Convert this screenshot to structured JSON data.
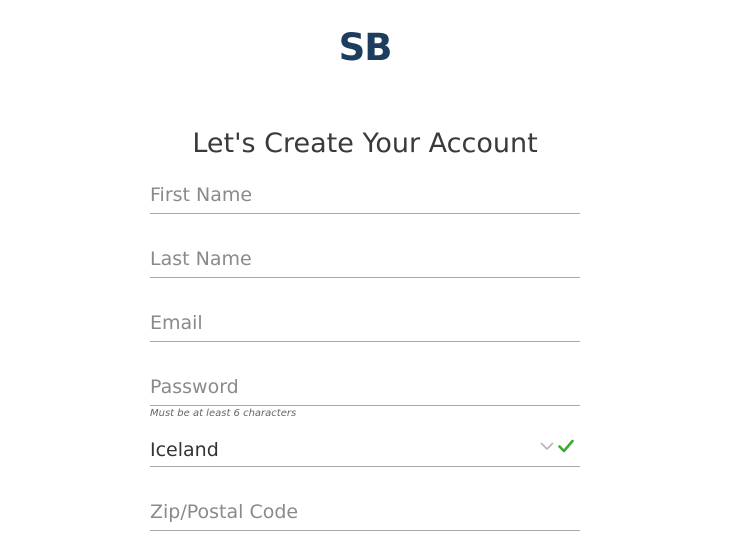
{
  "logo": {
    "text": "SB",
    "color": "#1d3d5e"
  },
  "title": "Let's Create Your Account",
  "form": {
    "first_name": {
      "placeholder": "First Name",
      "value": ""
    },
    "last_name": {
      "placeholder": "Last Name",
      "value": ""
    },
    "email": {
      "placeholder": "Email",
      "value": ""
    },
    "password": {
      "placeholder": "Password",
      "value": "",
      "hint": "Must be at least 6 characters"
    },
    "country": {
      "value": "Iceland",
      "icons": [
        "chevron-down-icon",
        "checkmark-icon"
      ],
      "valid_color": "#3aaa35"
    },
    "zip": {
      "placeholder": "Zip/Postal Code",
      "value": ""
    }
  }
}
